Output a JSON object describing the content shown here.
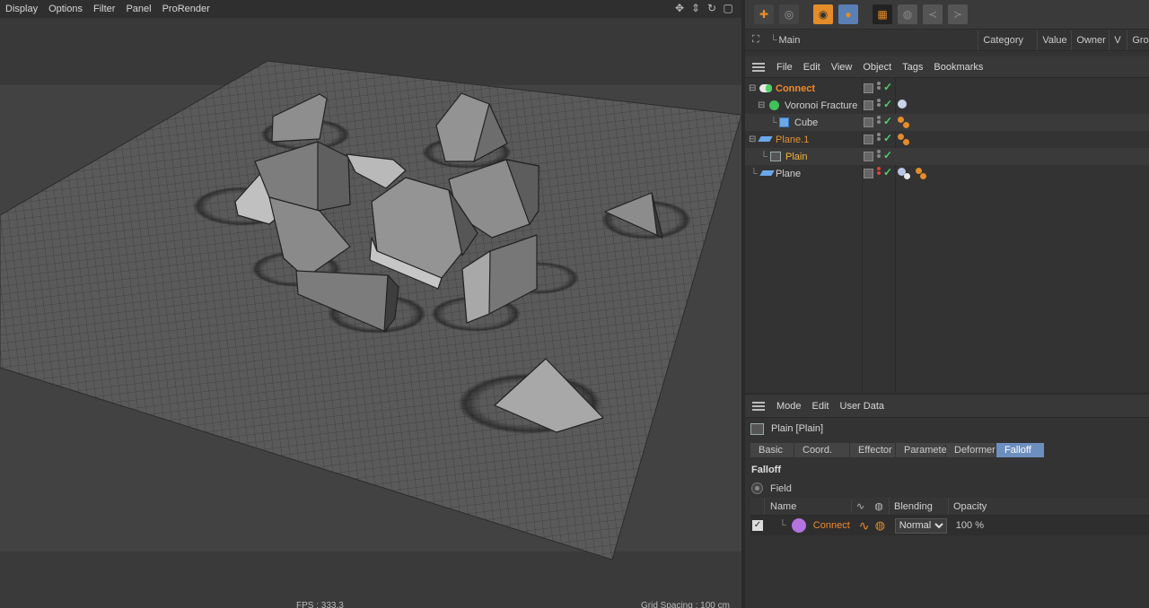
{
  "viewport": {
    "menu": [
      "Display",
      "Options",
      "Filter",
      "Panel",
      "ProRender"
    ],
    "hud_left": "FPS : 333.3",
    "hud_right": "Grid Spacing : 100 cm"
  },
  "layer_bar": {
    "layer_name": "Main"
  },
  "attr_columns": [
    "Category",
    "Value",
    "Owner",
    "V",
    "Gro"
  ],
  "object_manager": {
    "menu": [
      "File",
      "Edit",
      "View",
      "Object",
      "Tags",
      "Bookmarks"
    ],
    "objects": [
      {
        "name": "Connect",
        "color": "#f08a2a"
      },
      {
        "name": "Voronoi Fracture",
        "color": "#d0d0d0"
      },
      {
        "name": "Cube",
        "color": "#d0d0d0"
      },
      {
        "name": "Plane.1",
        "color": "#e8902e"
      },
      {
        "name": "Plain",
        "color": "#f2b63a"
      },
      {
        "name": "Plane",
        "color": "#d0d0d0"
      }
    ]
  },
  "attribute_manager": {
    "menu": [
      "Mode",
      "Edit",
      "User Data"
    ],
    "object_title": "Plain [Plain]",
    "tabs": [
      "Basic",
      "Coord.",
      "Effector",
      "Parameter",
      "Deformer",
      "Falloff"
    ],
    "active_tab": "Falloff",
    "section_title": "Falloff",
    "field_label": "Field",
    "table_headers": {
      "name": "Name",
      "blending": "Blending",
      "opacity": "Opacity"
    },
    "row": {
      "name": "Connect",
      "blending": "Normal",
      "opacity": "100 %"
    }
  },
  "colors": {
    "accent": "#6d8fc0",
    "selected_text": "#f08a2a",
    "check": "#4fd06a"
  }
}
